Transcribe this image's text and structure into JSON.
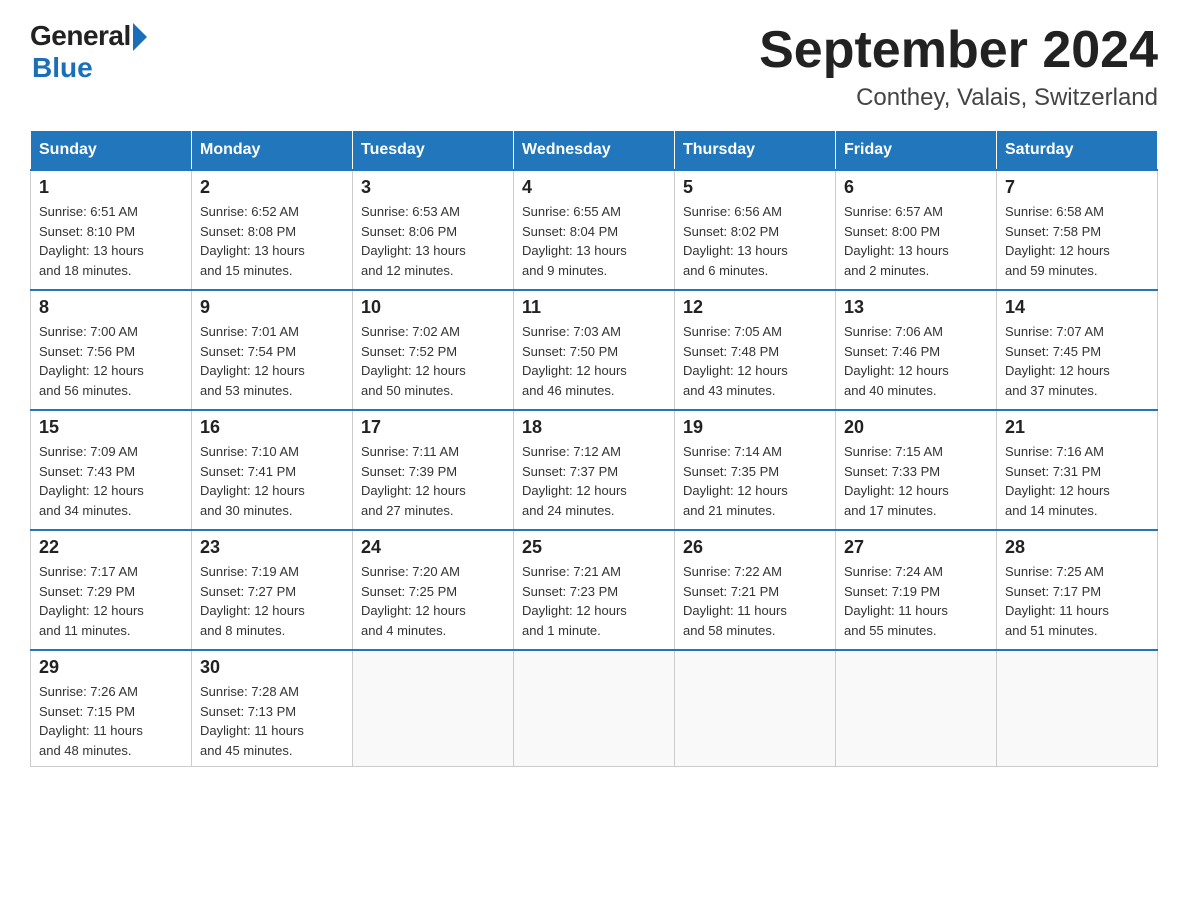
{
  "logo": {
    "general": "General",
    "blue": "Blue"
  },
  "title": "September 2024",
  "subtitle": "Conthey, Valais, Switzerland",
  "weekdays": [
    "Sunday",
    "Monday",
    "Tuesday",
    "Wednesday",
    "Thursday",
    "Friday",
    "Saturday"
  ],
  "weeks": [
    [
      {
        "day": "1",
        "info": "Sunrise: 6:51 AM\nSunset: 8:10 PM\nDaylight: 13 hours\nand 18 minutes."
      },
      {
        "day": "2",
        "info": "Sunrise: 6:52 AM\nSunset: 8:08 PM\nDaylight: 13 hours\nand 15 minutes."
      },
      {
        "day": "3",
        "info": "Sunrise: 6:53 AM\nSunset: 8:06 PM\nDaylight: 13 hours\nand 12 minutes."
      },
      {
        "day": "4",
        "info": "Sunrise: 6:55 AM\nSunset: 8:04 PM\nDaylight: 13 hours\nand 9 minutes."
      },
      {
        "day": "5",
        "info": "Sunrise: 6:56 AM\nSunset: 8:02 PM\nDaylight: 13 hours\nand 6 minutes."
      },
      {
        "day": "6",
        "info": "Sunrise: 6:57 AM\nSunset: 8:00 PM\nDaylight: 13 hours\nand 2 minutes."
      },
      {
        "day": "7",
        "info": "Sunrise: 6:58 AM\nSunset: 7:58 PM\nDaylight: 12 hours\nand 59 minutes."
      }
    ],
    [
      {
        "day": "8",
        "info": "Sunrise: 7:00 AM\nSunset: 7:56 PM\nDaylight: 12 hours\nand 56 minutes."
      },
      {
        "day": "9",
        "info": "Sunrise: 7:01 AM\nSunset: 7:54 PM\nDaylight: 12 hours\nand 53 minutes."
      },
      {
        "day": "10",
        "info": "Sunrise: 7:02 AM\nSunset: 7:52 PM\nDaylight: 12 hours\nand 50 minutes."
      },
      {
        "day": "11",
        "info": "Sunrise: 7:03 AM\nSunset: 7:50 PM\nDaylight: 12 hours\nand 46 minutes."
      },
      {
        "day": "12",
        "info": "Sunrise: 7:05 AM\nSunset: 7:48 PM\nDaylight: 12 hours\nand 43 minutes."
      },
      {
        "day": "13",
        "info": "Sunrise: 7:06 AM\nSunset: 7:46 PM\nDaylight: 12 hours\nand 40 minutes."
      },
      {
        "day": "14",
        "info": "Sunrise: 7:07 AM\nSunset: 7:45 PM\nDaylight: 12 hours\nand 37 minutes."
      }
    ],
    [
      {
        "day": "15",
        "info": "Sunrise: 7:09 AM\nSunset: 7:43 PM\nDaylight: 12 hours\nand 34 minutes."
      },
      {
        "day": "16",
        "info": "Sunrise: 7:10 AM\nSunset: 7:41 PM\nDaylight: 12 hours\nand 30 minutes."
      },
      {
        "day": "17",
        "info": "Sunrise: 7:11 AM\nSunset: 7:39 PM\nDaylight: 12 hours\nand 27 minutes."
      },
      {
        "day": "18",
        "info": "Sunrise: 7:12 AM\nSunset: 7:37 PM\nDaylight: 12 hours\nand 24 minutes."
      },
      {
        "day": "19",
        "info": "Sunrise: 7:14 AM\nSunset: 7:35 PM\nDaylight: 12 hours\nand 21 minutes."
      },
      {
        "day": "20",
        "info": "Sunrise: 7:15 AM\nSunset: 7:33 PM\nDaylight: 12 hours\nand 17 minutes."
      },
      {
        "day": "21",
        "info": "Sunrise: 7:16 AM\nSunset: 7:31 PM\nDaylight: 12 hours\nand 14 minutes."
      }
    ],
    [
      {
        "day": "22",
        "info": "Sunrise: 7:17 AM\nSunset: 7:29 PM\nDaylight: 12 hours\nand 11 minutes."
      },
      {
        "day": "23",
        "info": "Sunrise: 7:19 AM\nSunset: 7:27 PM\nDaylight: 12 hours\nand 8 minutes."
      },
      {
        "day": "24",
        "info": "Sunrise: 7:20 AM\nSunset: 7:25 PM\nDaylight: 12 hours\nand 4 minutes."
      },
      {
        "day": "25",
        "info": "Sunrise: 7:21 AM\nSunset: 7:23 PM\nDaylight: 12 hours\nand 1 minute."
      },
      {
        "day": "26",
        "info": "Sunrise: 7:22 AM\nSunset: 7:21 PM\nDaylight: 11 hours\nand 58 minutes."
      },
      {
        "day": "27",
        "info": "Sunrise: 7:24 AM\nSunset: 7:19 PM\nDaylight: 11 hours\nand 55 minutes."
      },
      {
        "day": "28",
        "info": "Sunrise: 7:25 AM\nSunset: 7:17 PM\nDaylight: 11 hours\nand 51 minutes."
      }
    ],
    [
      {
        "day": "29",
        "info": "Sunrise: 7:26 AM\nSunset: 7:15 PM\nDaylight: 11 hours\nand 48 minutes."
      },
      {
        "day": "30",
        "info": "Sunrise: 7:28 AM\nSunset: 7:13 PM\nDaylight: 11 hours\nand 45 minutes."
      },
      {
        "day": "",
        "info": ""
      },
      {
        "day": "",
        "info": ""
      },
      {
        "day": "",
        "info": ""
      },
      {
        "day": "",
        "info": ""
      },
      {
        "day": "",
        "info": ""
      }
    ]
  ]
}
